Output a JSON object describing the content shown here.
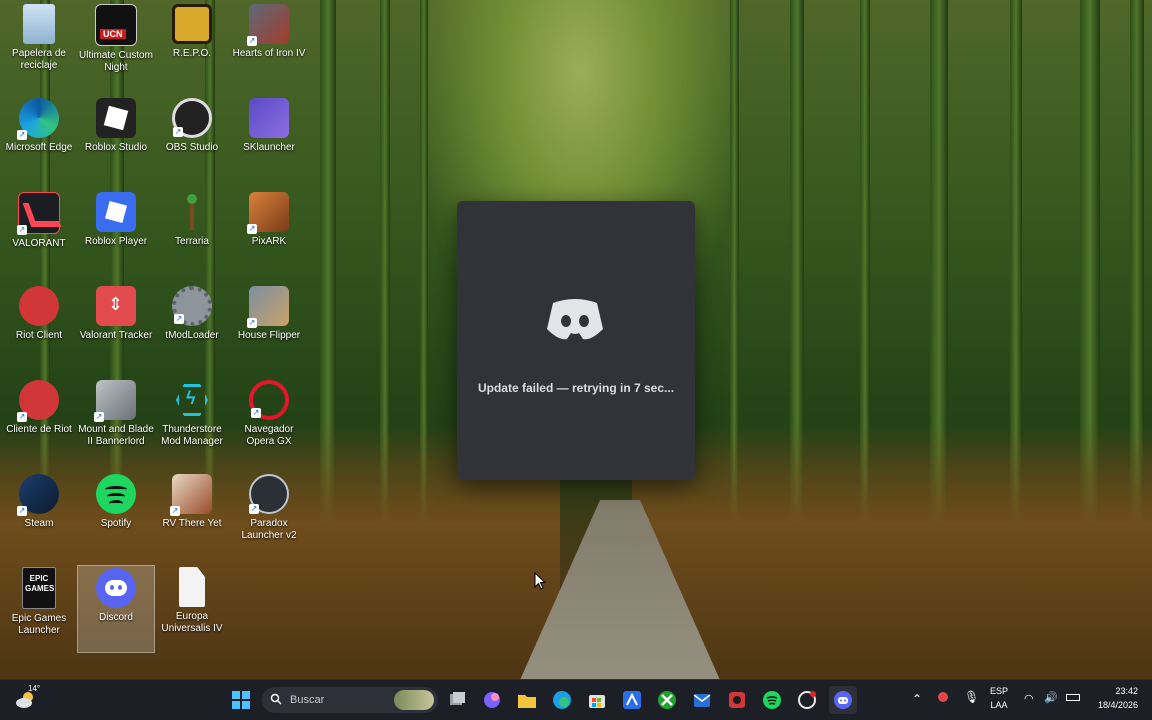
{
  "desktop": {
    "icons": [
      {
        "label": "Papelera de reciclaje"
      },
      {
        "label": "Ultimate Custom Night"
      },
      {
        "label": "R.E.P.O."
      },
      {
        "label": "Hearts of Iron IV"
      },
      {
        "label": "Microsoft Edge"
      },
      {
        "label": "Roblox Studio"
      },
      {
        "label": "OBS Studio"
      },
      {
        "label": "SKlauncher"
      },
      {
        "label": "VALORANT"
      },
      {
        "label": "Roblox Player"
      },
      {
        "label": "Terraria"
      },
      {
        "label": "PixARK"
      },
      {
        "label": "Riot Client"
      },
      {
        "label": "Valorant Tracker"
      },
      {
        "label": "tModLoader"
      },
      {
        "label": "House Flipper"
      },
      {
        "label": "Cliente de Riot"
      },
      {
        "label": "Mount and Blade II Bannerlord"
      },
      {
        "label": "Thunderstore Mod Manager"
      },
      {
        "label": "Navegador Opera GX"
      },
      {
        "label": "Steam"
      },
      {
        "label": "Spotify"
      },
      {
        "label": "RV There Yet"
      },
      {
        "label": "Paradox Launcher v2"
      },
      {
        "label": "Epic Games Launcher"
      },
      {
        "label": "Discord"
      },
      {
        "label": "Europa Universalis IV"
      }
    ],
    "icon_badge_text": "UCN",
    "epic_badge_text": "EPIC GAMES"
  },
  "splash": {
    "status": "Update failed — retrying in 7 sec..."
  },
  "taskbar": {
    "weather_temp": "14°",
    "search_placeholder": "Buscar",
    "lang_line1": "ESP",
    "lang_line2": "LAA",
    "time": "23:42",
    "date": "18/4/2026"
  },
  "colors": {
    "splash_bg": "#313338",
    "taskbar_bg": "#1c1f26",
    "discord_blurple": "#5865F2"
  }
}
